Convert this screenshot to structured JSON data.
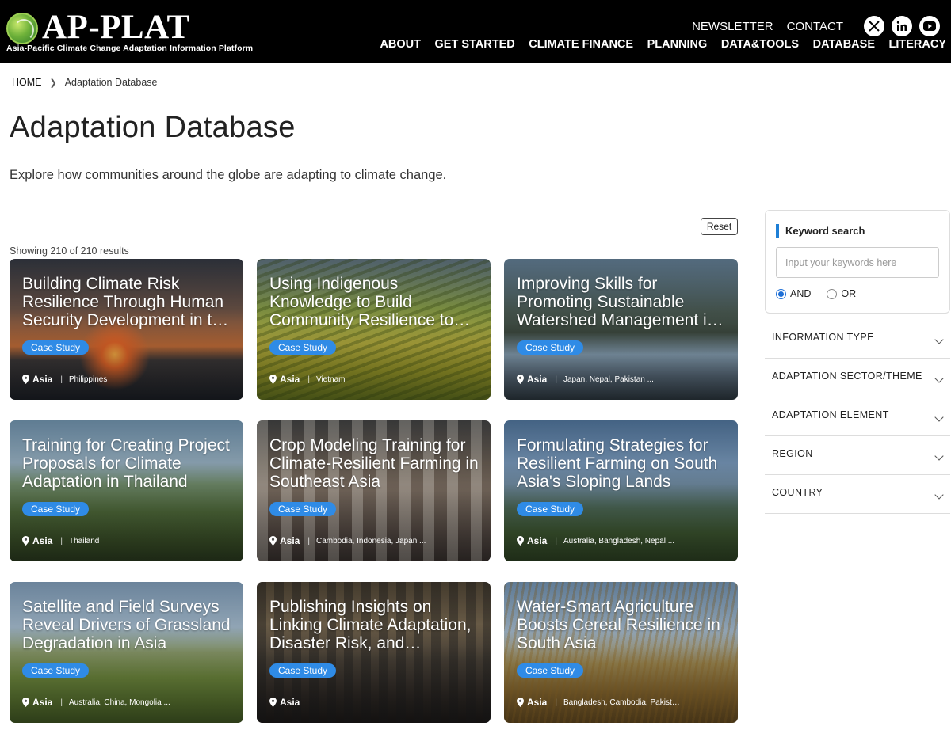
{
  "header": {
    "logo_title": "AP-PLAT",
    "logo_subtitle": "Asia-Pacific Climate Change Adaptation Information Platform",
    "utility_links": [
      "NEWSLETTER",
      "CONTACT"
    ],
    "social_icons": [
      "x-icon",
      "linkedin-icon",
      "youtube-icon"
    ],
    "nav": [
      "ABOUT",
      "GET STARTED",
      "CLIMATE FINANCE",
      "PLANNING",
      "DATA&TOOLS",
      "DATABASE",
      "LITERACY"
    ]
  },
  "breadcrumb": {
    "home": "HOME",
    "current": "Adaptation Database"
  },
  "page": {
    "title": "Adaptation Database",
    "intro": "Explore how communities around the globe are adapting to climate change.",
    "reset_label": "Reset",
    "results_text": "Showing 210 of 210 results"
  },
  "cards": [
    {
      "title": "Building Climate Risk Resilience Through Human Security Development in the Philippines",
      "badge": "Case Study",
      "region": "Asia",
      "countries": "Philippines"
    },
    {
      "title": "Using Indigenous Knowledge to Build Community Resilience to Climate Change",
      "badge": "Case Study",
      "region": "Asia",
      "countries": "Vietnam"
    },
    {
      "title": "Improving Skills for Promoting Sustainable Watershed Management in Asia",
      "badge": "Case Study",
      "region": "Asia",
      "countries": "Japan, Nepal, Pakistan ..."
    },
    {
      "title": "Training for Creating Project Proposals for Climate Adaptation in Thailand",
      "badge": "Case Study",
      "region": "Asia",
      "countries": "Thailand"
    },
    {
      "title": "Crop Modeling Training for Climate-Resilient Farming in Southeast Asia",
      "badge": "Case Study",
      "region": "Asia",
      "countries": "Cambodia, Indonesia, Japan ..."
    },
    {
      "title": "Formulating Strategies for Resilient Farming on South Asia's Sloping Lands",
      "badge": "Case Study",
      "region": "Asia",
      "countries": "Australia, Bangladesh, Nepal ..."
    },
    {
      "title": "Satellite and Field Surveys Reveal Drivers of Grassland Degradation in Asia",
      "badge": "Case Study",
      "region": "Asia",
      "countries": "Australia, China, Mongolia ..."
    },
    {
      "title": "Publishing Insights on Linking Climate Adaptation, Disaster Risk, and Development",
      "badge": "Case Study",
      "region": "Asia",
      "countries": ""
    },
    {
      "title": "Water-Smart Agriculture Boosts Cereal Resilience in South Asia",
      "badge": "Case Study",
      "region": "Asia",
      "countries": "Bangladesh, Cambodia, Pakistan ..."
    }
  ],
  "sidebar": {
    "search_label": "Keyword search",
    "search_placeholder": "Input your keywords here",
    "search_value": "",
    "operators": [
      "AND",
      "OR"
    ],
    "selected_operator": "AND",
    "filters": [
      "INFORMATION TYPE",
      "ADAPTATION SECTOR/THEME",
      "ADAPTATION ELEMENT",
      "REGION",
      "COUNTRY"
    ]
  },
  "colors": {
    "header_bg": "#000000",
    "badge": "#2f8be6",
    "accent": "#1e7fd6"
  }
}
